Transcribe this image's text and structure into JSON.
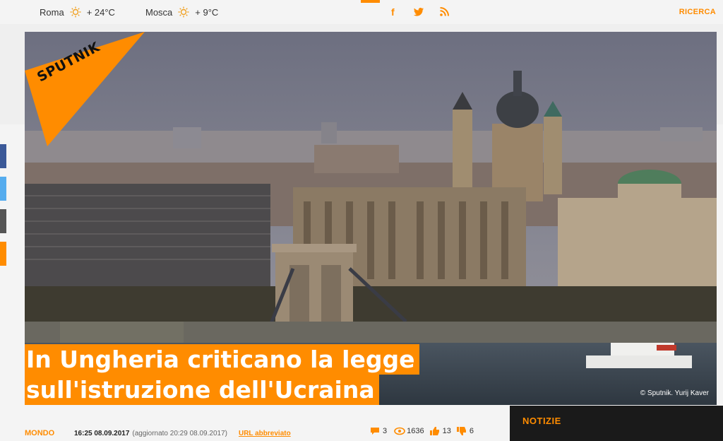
{
  "weather": [
    {
      "city": "Roma",
      "temp": "+ 24°C",
      "icon": "sun-icon"
    },
    {
      "city": "Mosca",
      "temp": "+ 9°C",
      "icon": "sun-icon"
    }
  ],
  "social": {
    "facebook": "f",
    "twitter": "twitter-icon",
    "rss": "rss-icon"
  },
  "search_label": "RICERCA",
  "brand": "SPUTNIK",
  "headline": {
    "line1": "In Ungheria criticano la legge",
    "line2": "sull'istruzione dell'Ucraina"
  },
  "photo_credit": "© Sputnik. Yurij Kaver",
  "meta": {
    "section": "MONDO",
    "date": "16:25 08.09.2017",
    "updated": "(aggiornato 20:29 08.09.2017)",
    "short_url": "URL abbreviato"
  },
  "stats": {
    "comments": "3",
    "views": "1636",
    "likes": "13",
    "dislikes": "6"
  },
  "sidebar": {
    "title": "NOTIZIE"
  },
  "colors": {
    "accent": "#ff8c00",
    "facebook": "#3b5998",
    "twitter": "#55acee",
    "share_grey": "#555555"
  }
}
